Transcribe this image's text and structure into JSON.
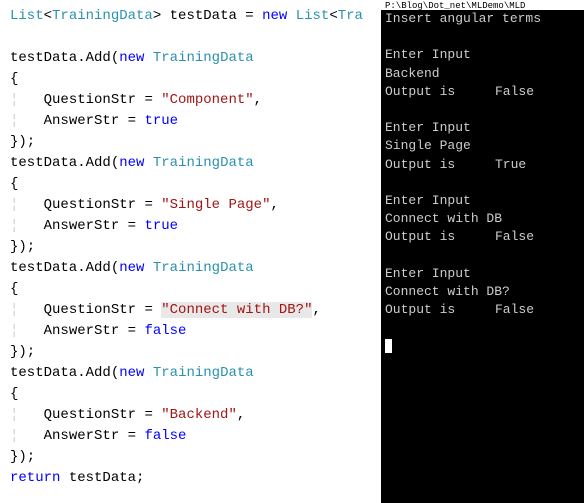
{
  "editor": {
    "decl": {
      "listType": "List",
      "generic": "TrainingData",
      "varName": "testData",
      "equals": "=",
      "new": "new",
      "listType2": "List",
      "generic2Cut": "Tra"
    },
    "blocks": [
      {
        "question": "\"Component\"",
        "answerKw": "true"
      },
      {
        "question": "\"Single Page\"",
        "answerKw": "true"
      },
      {
        "question": "\"Connect with DB?\"",
        "answerKw": "false",
        "highlight": true
      },
      {
        "question": "\"Backend\"",
        "answerKw": "false"
      }
    ],
    "addCall": ".Add(",
    "trainingDataType": "TrainingData",
    "newKw": "new",
    "openBrace": "{",
    "closeBraceParen": "});",
    "questionLabel": "QuestionStr = ",
    "answerLabel": "AnswerStr = ",
    "returnKw": "return",
    "returnVar": "testData",
    "semi": ";"
  },
  "terminal": {
    "titleFragment": "P:\\Blog\\Dot_net\\MLDemo\\MLD",
    "prompt": "Insert angular terms",
    "entries": [
      {
        "input": "Backend",
        "output": "False"
      },
      {
        "input": "Single Page",
        "output": "True"
      },
      {
        "input": "Connect with DB",
        "output": "False"
      },
      {
        "input": "Connect with DB?",
        "output": "False"
      }
    ],
    "enterInput": "Enter Input",
    "outputIs": "Output is"
  }
}
